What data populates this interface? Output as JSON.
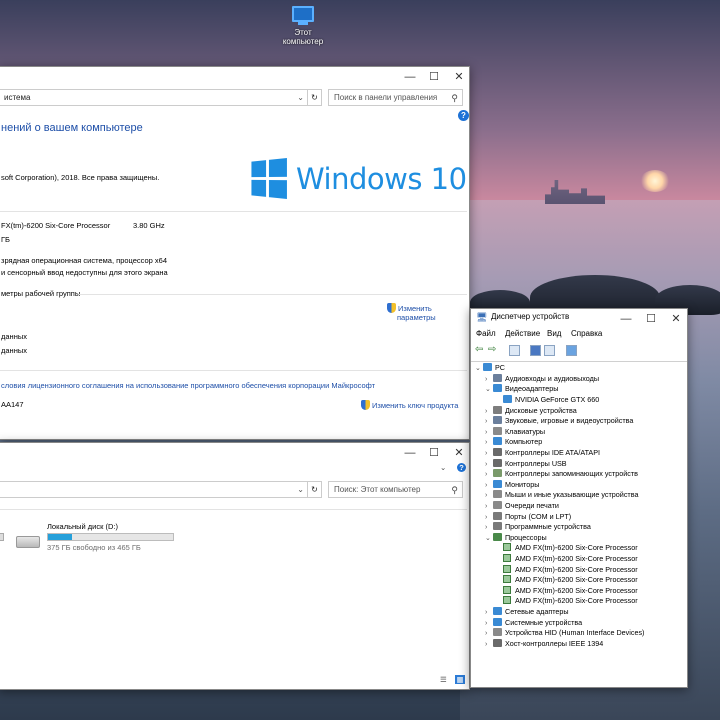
{
  "desktop": {
    "icon_label": "Этот компьютер"
  },
  "system_window": {
    "address": "истема",
    "search_placeholder": "Поиск в панели управления",
    "heading": "нений о вашем компьютере",
    "copyright": "soft Corporation), 2018. Все права защищены.",
    "windows_brand": "Windows 10",
    "processor": "FX(tm)-6200 Six-Core Processor",
    "processor_speed": "3.80 GHz",
    "ram_unit": "ГБ",
    "system_type": "зрядная операционная система, процессор x64",
    "pen_touch": "и сенсорный ввод недоступны для этого экрана",
    "workgroup_header": "метры рабочей группы",
    "change_settings_1": "Изменить",
    "change_settings_2": "параметры",
    "row_a": "данных",
    "row_b": "данных",
    "license_link": "словия лицензионного соглашения на использование программного обеспечения корпорации Майкрософт",
    "product_id": "AA147",
    "change_key": "Изменить ключ продукта"
  },
  "explorer_window": {
    "search_placeholder": "Поиск: Этот компьютер",
    "drive_label": "Локальный диск (D:)",
    "drive_free": "375 ГБ свободно из 465 ГБ",
    "drive_used_fraction": 0.19
  },
  "device_manager": {
    "title": "Диспетчер устройств",
    "menu": [
      "Файл",
      "Действие",
      "Вид",
      "Справка"
    ],
    "root": "PC",
    "tree": [
      {
        "label": "Аудиовходы и аудиовыходы",
        "level": 1,
        "expander": ">",
        "color": "#6b7f9c"
      },
      {
        "label": "Видеоадаптеры",
        "level": 1,
        "expander": "v",
        "color": "#3a8ad4"
      },
      {
        "label": "NVIDIA GeForce GTX 660",
        "level": 2,
        "expander": "",
        "color": "#3a8ad4"
      },
      {
        "label": "Дисковые устройства",
        "level": 1,
        "expander": ">",
        "color": "#7d7d7d"
      },
      {
        "label": "Звуковые, игровые и видеоустройства",
        "level": 1,
        "expander": ">",
        "color": "#6b7f9c"
      },
      {
        "label": "Клавиатуры",
        "level": 1,
        "expander": ">",
        "color": "#8a8a8a"
      },
      {
        "label": "Компьютер",
        "level": 1,
        "expander": ">",
        "color": "#3a8ad4"
      },
      {
        "label": "Контроллеры IDE ATA/ATAPI",
        "level": 1,
        "expander": ">",
        "color": "#6a6a6a"
      },
      {
        "label": "Контроллеры USB",
        "level": 1,
        "expander": ">",
        "color": "#6a6a6a"
      },
      {
        "label": "Контроллеры запоминающих устройств",
        "level": 1,
        "expander": ">",
        "color": "#7a9a6a"
      },
      {
        "label": "Мониторы",
        "level": 1,
        "expander": ">",
        "color": "#3a8ad4"
      },
      {
        "label": "Мыши и иные указывающие устройства",
        "level": 1,
        "expander": ">",
        "color": "#8a8a8a"
      },
      {
        "label": "Очереди печати",
        "level": 1,
        "expander": ">",
        "color": "#8a8a8a"
      },
      {
        "label": "Порты (COM и LPT)",
        "level": 1,
        "expander": ">",
        "color": "#7a7a7a"
      },
      {
        "label": "Программные устройства",
        "level": 1,
        "expander": ">",
        "color": "#7a7a7a"
      },
      {
        "label": "Процессоры",
        "level": 1,
        "expander": "v",
        "color": "#4a8a4a"
      },
      {
        "label": "AMD FX(tm)-6200 Six-Core Processor",
        "level": 2,
        "expander": "",
        "color": "cpu"
      },
      {
        "label": "AMD FX(tm)-6200 Six-Core Processor",
        "level": 2,
        "expander": "",
        "color": "cpu"
      },
      {
        "label": "AMD FX(tm)-6200 Six-Core Processor",
        "level": 2,
        "expander": "",
        "color": "cpu"
      },
      {
        "label": "AMD FX(tm)-6200 Six-Core Processor",
        "level": 2,
        "expander": "",
        "color": "cpu"
      },
      {
        "label": "AMD FX(tm)-6200 Six-Core Processor",
        "level": 2,
        "expander": "",
        "color": "cpu"
      },
      {
        "label": "AMD FX(tm)-6200 Six-Core Processor",
        "level": 2,
        "expander": "",
        "color": "cpu"
      },
      {
        "label": "Сетевые адаптеры",
        "level": 1,
        "expander": ">",
        "color": "#3a8ad4"
      },
      {
        "label": "Системные устройства",
        "level": 1,
        "expander": ">",
        "color": "#3a8ad4"
      },
      {
        "label": "Устройства HID (Human Interface Devices)",
        "level": 1,
        "expander": ">",
        "color": "#8a8a8a"
      },
      {
        "label": "Хост-контроллеры IEEE 1394",
        "level": 1,
        "expander": ">",
        "color": "#6a6a6a"
      }
    ]
  }
}
